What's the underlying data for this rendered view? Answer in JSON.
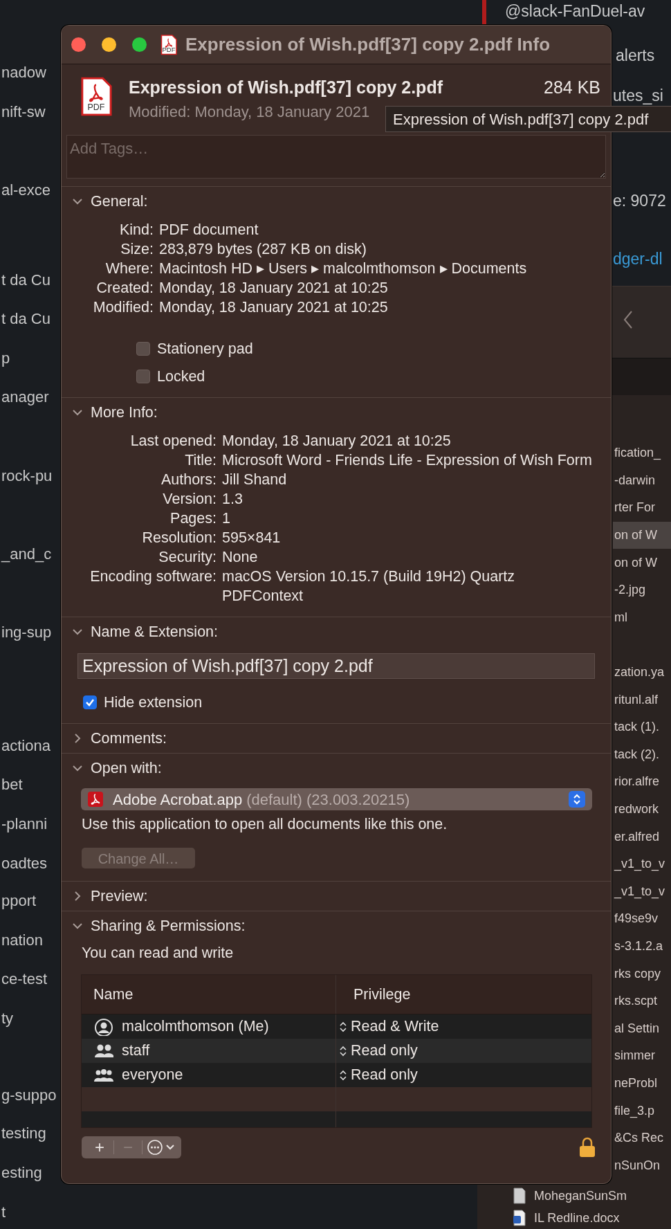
{
  "background": {
    "left_items": [
      "nadow",
      "nift-sw",
      "al-exce",
      "t da Cu",
      "t da Cu",
      "p",
      "anager",
      "rock-pu",
      "_and_c",
      "ing-sup",
      "actiona",
      "bet",
      "-planni",
      "oadtes",
      "pport",
      "nation",
      "ce-test",
      "ty",
      "g-suppo",
      "testing",
      "esting",
      "t"
    ],
    "chat_lines": [
      {
        "text": "@slack-FanDuel-av",
        "kind": "plain"
      },
      {
        "text": "alerts",
        "kind": "plain"
      },
      {
        "text": "utes_si",
        "kind": "plain"
      },
      {
        "text": "e: 9072",
        "kind": "plain"
      },
      {
        "text": "dger-dl",
        "kind": "link"
      }
    ],
    "finder_rows": [
      {
        "name": "fication_",
        "selected": false
      },
      {
        "name": "-darwin",
        "selected": false
      },
      {
        "name": "rter For",
        "selected": false
      },
      {
        "name": "on of W",
        "selected": true
      },
      {
        "name": "on of W",
        "selected": false
      },
      {
        "name": "-2.jpg",
        "selected": false
      },
      {
        "name": "ml",
        "selected": false
      },
      {
        "name": "zation.ya",
        "selected": false
      },
      {
        "name": "ritunl.alf",
        "selected": false
      },
      {
        "name": "tack (1).",
        "selected": false
      },
      {
        "name": "tack (2).",
        "selected": false
      },
      {
        "name": "rior.alfre",
        "selected": false
      },
      {
        "name": "redwork",
        "selected": false
      },
      {
        "name": "er.alfred",
        "selected": false
      },
      {
        "name": "_v1_to_v",
        "selected": false
      },
      {
        "name": "_v1_to_v",
        "selected": false
      },
      {
        "name": "f49se9v",
        "selected": false
      },
      {
        "name": "s-3.1.2.a",
        "selected": false
      },
      {
        "name": "rks copy",
        "selected": false
      },
      {
        "name": "rks.scpt",
        "selected": false
      },
      {
        "name": "al Settin",
        "selected": false
      },
      {
        "name": "simmer",
        "selected": false
      },
      {
        "name": "neProbl",
        "selected": false
      },
      {
        "name": "file_3.p",
        "selected": false
      },
      {
        "name": "&Cs Rec",
        "selected": false
      },
      {
        "name": "nSunOn",
        "selected": false
      },
      {
        "name": "MoheganSunSm",
        "selected": false
      },
      {
        "name": "IL Redline.docx",
        "selected": false
      }
    ]
  },
  "window": {
    "title": "Expression of Wish.pdf[37] copy 2.pdf Info",
    "title_icon_label": "PDF",
    "file": {
      "icon_label": "PDF",
      "name": "Expression of Wish.pdf[37] copy 2.pdf",
      "size": "284 KB",
      "modified": "Modified: Monday, 18 January 2021"
    },
    "tooltip": "Expression of Wish.pdf[37] copy 2.pdf",
    "tags": {
      "placeholder": "Add Tags…"
    },
    "sections": [
      {
        "kind": "info",
        "title": "General:",
        "expanded": true,
        "rows": [
          {
            "label": "Kind:",
            "value": "PDF document"
          },
          {
            "label": "Size:",
            "value": "283,879 bytes (287 KB on disk)"
          },
          {
            "label": "Where:",
            "value": "Macintosh HD ▸ Users ▸ malcolmthomson ▸ Documents"
          },
          {
            "label": "Created:",
            "value": "Monday, 18 January 2021 at 10:25"
          },
          {
            "label": "Modified:",
            "value": "Monday, 18 January 2021 at 10:25"
          }
        ],
        "checkboxes": [
          {
            "label": "Stationery pad",
            "checked": false
          },
          {
            "label": "Locked",
            "checked": false
          }
        ]
      },
      {
        "kind": "info",
        "title": "More Info:",
        "expanded": true,
        "rows": [
          {
            "label": "Last opened:",
            "value": "Monday, 18 January 2021 at 10:25"
          },
          {
            "label": "Title:",
            "value": "Microsoft Word - Friends Life - Expression of Wish Form"
          },
          {
            "label": "Authors:",
            "value": "Jill Shand"
          },
          {
            "label": "Version:",
            "value": "1.3"
          },
          {
            "label": "Pages:",
            "value": "1"
          },
          {
            "label": "Resolution:",
            "value": "595×841"
          },
          {
            "label": "Security:",
            "value": "None"
          },
          {
            "label": "Encoding software:",
            "value": "macOS Version 10.15.7 (Build 19H2) Quartz PDFContext"
          }
        ]
      },
      {
        "kind": "name",
        "title": "Name & Extension:",
        "expanded": true,
        "value": "Expression of Wish.pdf[37] copy 2.pdf",
        "checkboxes": [
          {
            "label": "Hide extension",
            "checked": true
          }
        ]
      },
      {
        "title": "Comments:",
        "expanded": false
      },
      {
        "kind": "open_with",
        "title": "Open with:",
        "expanded": true,
        "app": "Adobe Acrobat.app",
        "detail": "(default) (23.003.20215)",
        "note": "Use this application to open all documents like this one.",
        "button": {
          "label": "Change All…",
          "disabled": true
        }
      },
      {
        "title": "Preview:",
        "expanded": false
      },
      {
        "kind": "sharing",
        "title": "Sharing & Permissions:",
        "expanded": true,
        "note": "You can read and write",
        "columns": [
          "Name",
          "Privilege"
        ],
        "rows": [
          {
            "name": "malcolmthomson (Me)",
            "privilege": "Read & Write",
            "kind": "user"
          },
          {
            "name": "staff",
            "privilege": "Read only",
            "kind": "group"
          },
          {
            "name": "everyone",
            "privilege": "Read only",
            "kind": "everyone"
          }
        ],
        "toolbar": [
          {
            "label": "+",
            "disabled": false
          },
          {
            "label": "−",
            "disabled": true
          }
        ]
      }
    ]
  }
}
